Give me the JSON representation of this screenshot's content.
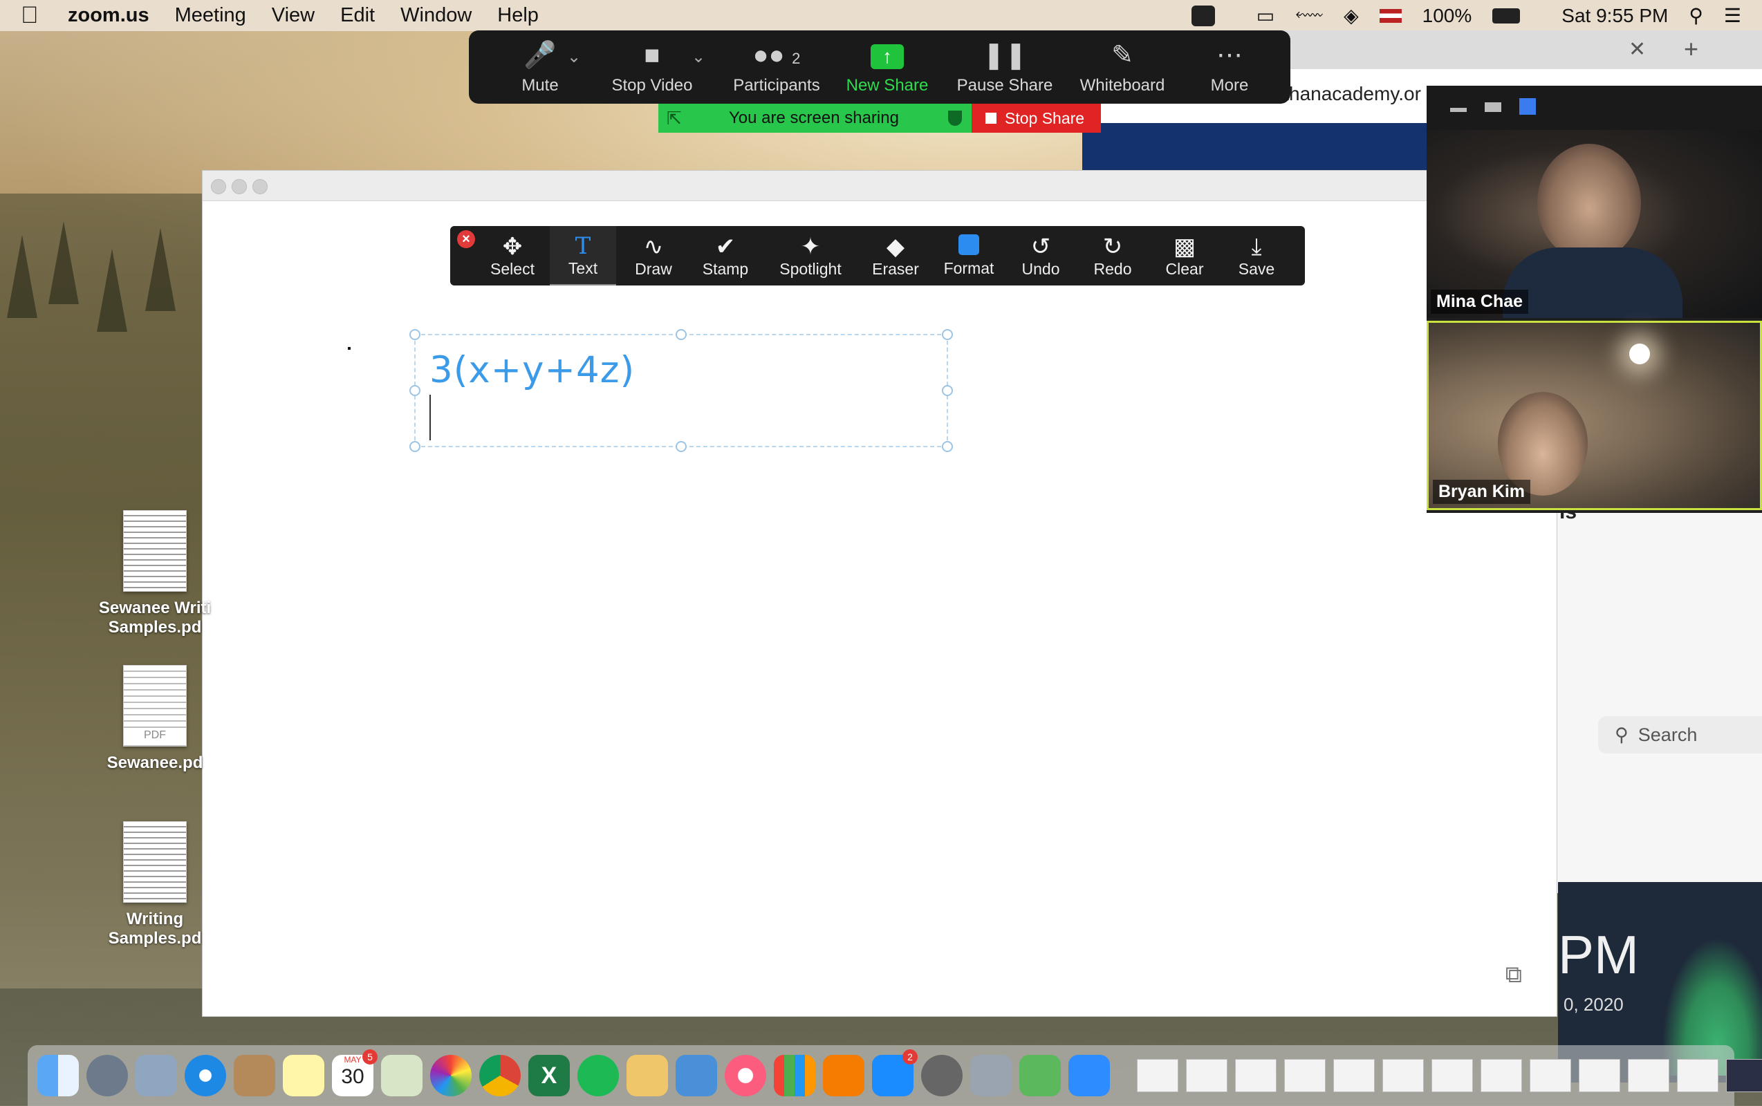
{
  "menubar": {
    "app_name": "zoom.us",
    "menus": [
      "Meeting",
      "View",
      "Edit",
      "Window",
      "Help"
    ],
    "battery": "100%",
    "clock": "Sat 9:55 PM"
  },
  "zoom_controls": {
    "mute": "Mute",
    "stop_video": "Stop Video",
    "participants": "Participants",
    "participant_count": "2",
    "new_share": "New Share",
    "pause_share": "Pause Share",
    "whiteboard": "Whiteboard",
    "more": "More"
  },
  "share_banner": {
    "status": "You are screen sharing",
    "stop": "Stop Share"
  },
  "annotation_toolbar": {
    "tools": [
      "Select",
      "Text",
      "Draw",
      "Stamp",
      "Spotlight",
      "Eraser",
      "Format",
      "Undo",
      "Redo",
      "Clear",
      "Save"
    ],
    "active": "Text"
  },
  "whiteboard": {
    "text": "3(x+y+4z)"
  },
  "browser": {
    "url": "khanacademy.or",
    "search_placeholder": "Search",
    "partial_time": "PM",
    "partial_date": "0, 2020",
    "partial_text": "is"
  },
  "participants": [
    {
      "name": "Mina Chae"
    },
    {
      "name": "Bryan Kim"
    }
  ],
  "desktop_files": [
    {
      "line1": "Sewanee Writi",
      "line2": "Samples.pd"
    },
    {
      "line1": "Sewanee.pd",
      "line2": ""
    },
    {
      "line1": "Writing",
      "line2": "Samples.pd"
    }
  ],
  "dock": {
    "calendar_month": "MAY",
    "calendar_day": "30",
    "calendar_badge": "5",
    "appstore_badge": "2"
  },
  "colors": {
    "share_green": "#29c64c",
    "stop_red": "#e02323",
    "annotation_blue": "#3b9be8",
    "speaker_border": "#c9e23d"
  }
}
